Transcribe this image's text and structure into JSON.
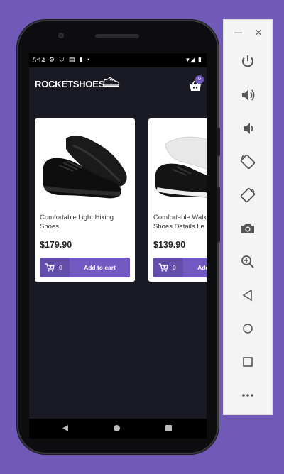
{
  "status_bar": {
    "time": "5:14"
  },
  "app": {
    "brand": "ROCKETSHOES",
    "cart_count": "0",
    "accent_color": "#7159c1",
    "background_color": "#191923"
  },
  "products": [
    {
      "title": "Comfortable Light Hiking\nShoes",
      "price": "$179.90",
      "amount": "0",
      "button_label": "Add to cart",
      "shoe_color": "black"
    },
    {
      "title": "Comfortable Walking\nShoes Details Le",
      "price": "$139.90",
      "amount": "0",
      "button_label": "Add to cart",
      "shoe_color": "black-white"
    }
  ],
  "emulator_toolbar": {
    "window_controls": [
      "minimize-icon",
      "close-icon"
    ],
    "buttons": [
      "power-icon",
      "volume-up-icon",
      "volume-down-icon",
      "rotate-left-icon",
      "rotate-right-icon",
      "camera-icon",
      "zoom-icon",
      "back-icon",
      "home-icon",
      "overview-icon",
      "more-icon"
    ]
  }
}
